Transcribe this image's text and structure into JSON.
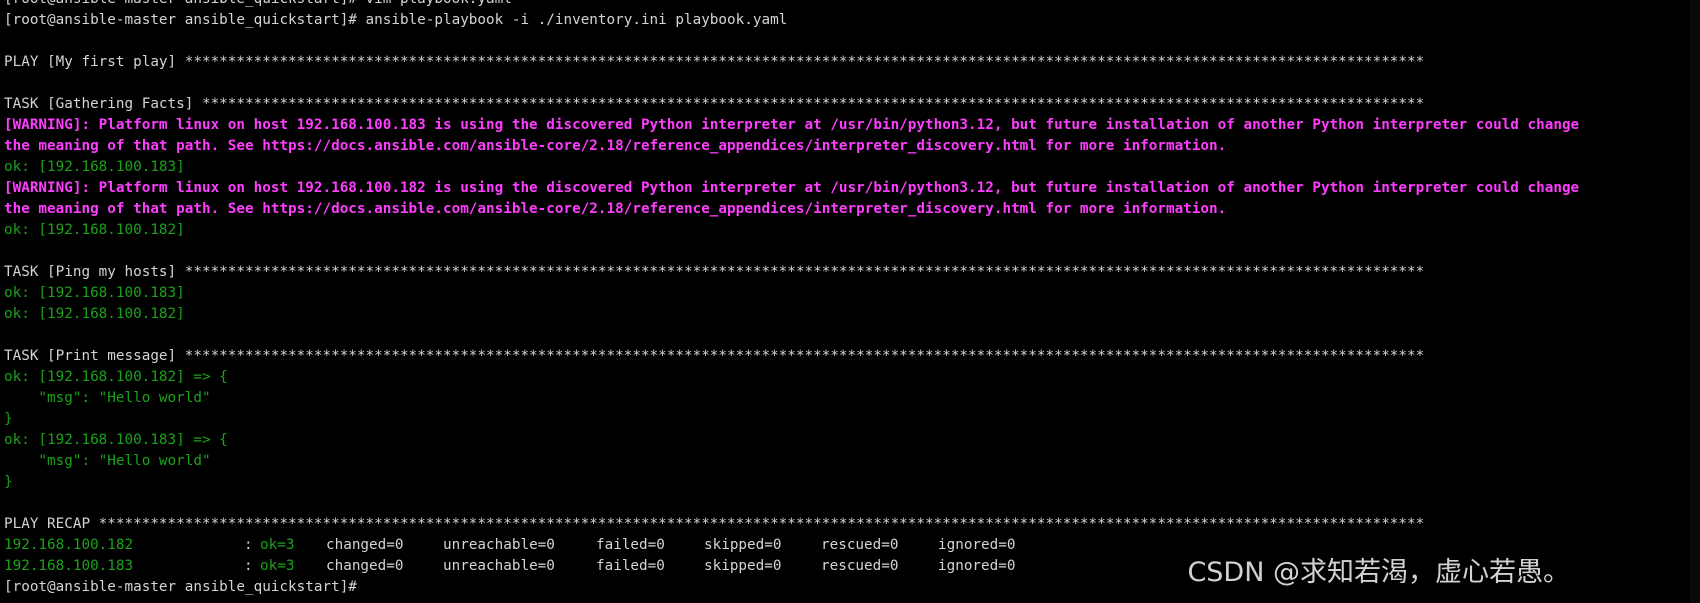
{
  "colors": {
    "background": "#000000",
    "text": "#d4d4d4",
    "ok": "#1aa31a",
    "warning": "#ff3dff"
  },
  "terminal": {
    "lines": [
      {
        "cls": "c-normal",
        "text": "[root@ansible-master ansible_quickstart]# vim playbook.yaml"
      },
      {
        "cls": "c-normal",
        "text": "[root@ansible-master ansible_quickstart]# ansible-playbook -i ./inventory.ini playbook.yaml"
      },
      {
        "cls": "c-normal",
        "text": ""
      },
      {
        "cls": "c-normal",
        "text": "PLAY [My first play] ************************************************************************************************************************************************"
      },
      {
        "cls": "c-normal",
        "text": ""
      },
      {
        "cls": "c-normal",
        "text": "TASK [Gathering Facts] **********************************************************************************************************************************************"
      },
      {
        "cls": "c-warn",
        "text": "[WARNING]: Platform linux on host 192.168.100.183 is using the discovered Python interpreter at /usr/bin/python3.12, but future installation of another Python interpreter could change"
      },
      {
        "cls": "c-warn",
        "text": "the meaning of that path. See https://docs.ansible.com/ansible-core/2.18/reference_appendices/interpreter_discovery.html for more information."
      },
      {
        "cls": "c-ok",
        "text": "ok: [192.168.100.183]"
      },
      {
        "cls": "c-warn",
        "text": "[WARNING]: Platform linux on host 192.168.100.182 is using the discovered Python interpreter at /usr/bin/python3.12, but future installation of another Python interpreter could change"
      },
      {
        "cls": "c-warn",
        "text": "the meaning of that path. See https://docs.ansible.com/ansible-core/2.18/reference_appendices/interpreter_discovery.html for more information."
      },
      {
        "cls": "c-ok",
        "text": "ok: [192.168.100.182]"
      },
      {
        "cls": "c-normal",
        "text": ""
      },
      {
        "cls": "c-normal",
        "text": "TASK [Ping my hosts] ************************************************************************************************************************************************"
      },
      {
        "cls": "c-ok",
        "text": "ok: [192.168.100.183]"
      },
      {
        "cls": "c-ok",
        "text": "ok: [192.168.100.182]"
      },
      {
        "cls": "c-normal",
        "text": ""
      },
      {
        "cls": "c-normal",
        "text": "TASK [Print message] ************************************************************************************************************************************************"
      },
      {
        "cls": "c-ok",
        "text": "ok: [192.168.100.182] => {"
      },
      {
        "cls": "c-ok",
        "text": "    \"msg\": \"Hello world\""
      },
      {
        "cls": "c-ok",
        "text": "}"
      },
      {
        "cls": "c-ok",
        "text": "ok: [192.168.100.183] => {"
      },
      {
        "cls": "c-ok",
        "text": "    \"msg\": \"Hello world\""
      },
      {
        "cls": "c-ok",
        "text": "}"
      },
      {
        "cls": "c-normal",
        "text": ""
      },
      {
        "cls": "c-normal",
        "text": "PLAY RECAP **********************************************************************************************************************************************************"
      }
    ],
    "recap": [
      {
        "host": "192.168.100.182",
        "sep": ":",
        "ok": "ok=3",
        "changed": "changed=0",
        "unreachable": "unreachable=0",
        "failed": "failed=0",
        "skipped": "skipped=0",
        "rescued": "rescued=0",
        "ignored": "ignored=0"
      },
      {
        "host": "192.168.100.183",
        "sep": ":",
        "ok": "ok=3",
        "changed": "changed=0",
        "unreachable": "unreachable=0",
        "failed": "failed=0",
        "skipped": "skipped=0",
        "rescued": "rescued=0",
        "ignored": "ignored=0"
      }
    ],
    "last_line": "[root@ansible-master ansible_quickstart]# "
  },
  "watermark": {
    "text": "CSDN @求知若渴，虚心若愚。"
  }
}
